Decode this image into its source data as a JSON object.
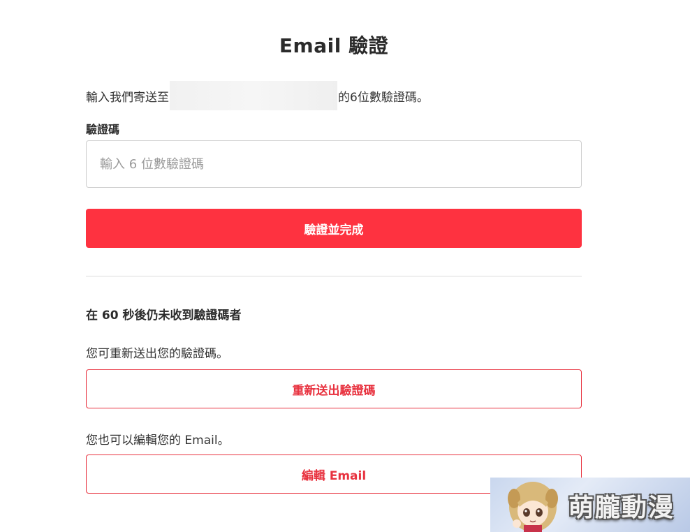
{
  "page": {
    "title": "Email 驗證",
    "intro_prefix": "輸入我們寄送至",
    "intro_suffix": "的6位數驗證碼。"
  },
  "form": {
    "code_label": "驗證碼",
    "code_placeholder": "輸入 6 位數驗證碼",
    "code_value": "",
    "submit_label": "驗證並完成"
  },
  "resend": {
    "heading": "在 60 秒後仍未收到驗證碼者",
    "hint": "您可重新送出您的驗證碼。",
    "button_label": "重新送出驗證碼"
  },
  "edit": {
    "hint": "您也可以編輯您的 Email。",
    "button_label": "編輯 Email"
  },
  "watermark": {
    "text": "萌朧動漫"
  },
  "colors": {
    "primary": "#fe3240",
    "outline": "#e8323f",
    "text": "#2b2b2b"
  }
}
